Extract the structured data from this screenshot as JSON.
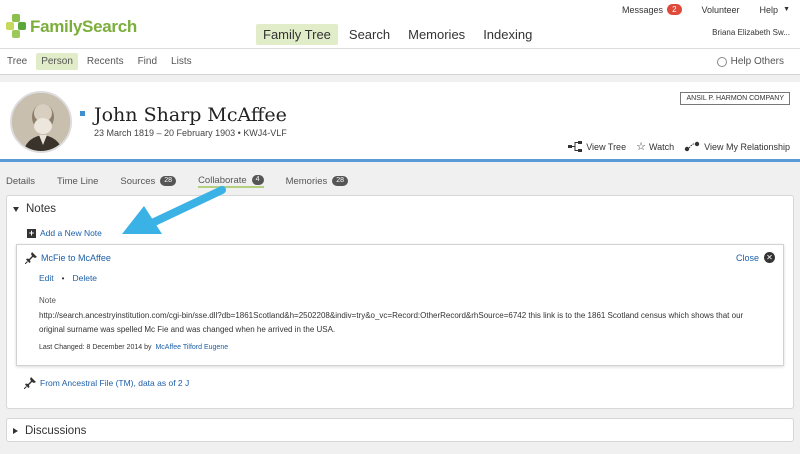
{
  "brand": {
    "name": "FamilySearch",
    "accent": "#7cae3c"
  },
  "main_nav": [
    {
      "label": "Family Tree",
      "active": true
    },
    {
      "label": "Search",
      "active": false
    },
    {
      "label": "Memories",
      "active": false
    },
    {
      "label": "Indexing",
      "active": false
    }
  ],
  "util_nav": {
    "messages_label": "Messages",
    "messages_count": "2",
    "volunteer_label": "Volunteer",
    "help_label": "Help",
    "help_icon": "caret-down-icon",
    "user_name": "Briana Elizabeth Sw..."
  },
  "sub_nav": [
    {
      "label": "Tree",
      "active": false
    },
    {
      "label": "Person",
      "active": true
    },
    {
      "label": "Recents",
      "active": false
    },
    {
      "label": "Find",
      "active": false
    },
    {
      "label": "Lists",
      "active": false
    }
  ],
  "help_others": {
    "label": "Help Others",
    "icon": "lifebuoy-icon"
  },
  "person": {
    "name": "John Sharp McAffee",
    "dates": "23 March 1819 – 20 February 1903 • KWJ4-VLF",
    "company": "ANSIL P. HARMON COMPANY",
    "actions": [
      {
        "label": "View Tree",
        "icon": "tree-icon"
      },
      {
        "label": "Watch",
        "icon": "star-icon"
      },
      {
        "label": "View My Relationship",
        "icon": "relationship-icon"
      }
    ]
  },
  "tabs": [
    {
      "label": "Details",
      "count": ""
    },
    {
      "label": "Time Line",
      "count": ""
    },
    {
      "label": "Sources",
      "count": "28"
    },
    {
      "label": "Collaborate",
      "count": "4",
      "active": true
    },
    {
      "label": "Memories",
      "count": "28"
    }
  ],
  "notes": {
    "heading": "Notes",
    "add_label": "Add a New Note",
    "card": {
      "title": "McFie to McAffee",
      "close_label": "Close",
      "edit_label": "Edit",
      "delete_label": "Delete",
      "note_label": "Note",
      "text": "http://search.ancestryinstitution.com/cgi-bin/sse.dll?db=1861Scotland&h=2502208&indiv=try&o_vc=Record:OtherRecord&rhSource=6742  this link is to the 1861 Scotland census which shows that our original surname was spelled Mc Fie and was changed when he arrived in the USA.",
      "last_changed": "Last Changed: 8 December 2014 by",
      "changed_by": "McAffee Tilford Eugene"
    },
    "second_note": "From Ancestral File (TM), data as of 2 J"
  },
  "discussions": {
    "heading": "Discussions"
  },
  "colors": {
    "link": "#1d5fa8",
    "highlight": "#e1ecc9",
    "header_rule": "#5a9ad6",
    "annotation_arrow": "#3bb2e6"
  }
}
